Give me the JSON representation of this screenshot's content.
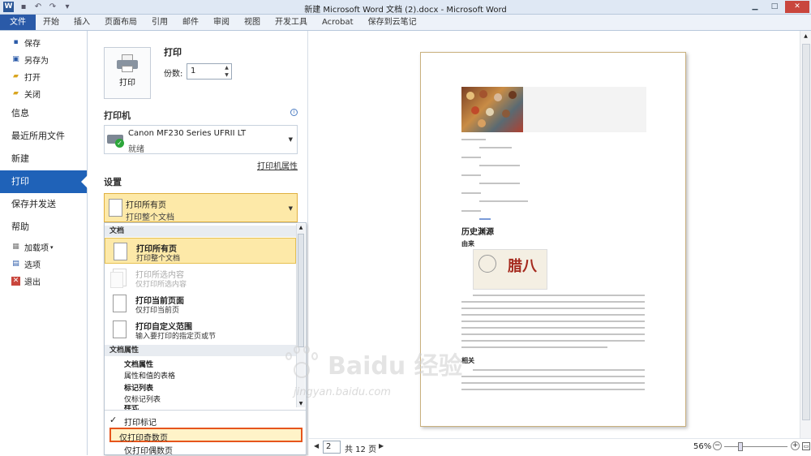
{
  "window": {
    "title": "新建 Microsoft Word 文档 (2).docx - Microsoft Word",
    "app_icon": "W"
  },
  "ribbon": {
    "tabs": [
      {
        "label": "文件",
        "active": true
      },
      {
        "label": "开始"
      },
      {
        "label": "插入"
      },
      {
        "label": "页面布局"
      },
      {
        "label": "引用"
      },
      {
        "label": "邮件"
      },
      {
        "label": "审阅"
      },
      {
        "label": "视图"
      },
      {
        "label": "开发工具"
      },
      {
        "label": "Acrobat"
      },
      {
        "label": "保存到云笔记"
      }
    ]
  },
  "nav": {
    "save": "保存",
    "save_as": "另存为",
    "open": "打开",
    "close": "关闭",
    "info": "信息",
    "recent": "最近所用文件",
    "new": "新建",
    "print": "打印",
    "save_send": "保存并发送",
    "help": "帮助",
    "addins": "加载项",
    "options": "选项",
    "exit": "退出"
  },
  "print_panel": {
    "section_title": "打印",
    "print_button": "打印",
    "copies_label": "份数:",
    "copies_value": "1",
    "printer_section": "打印机",
    "printer_name": "Canon MF230 Series UFRII LT",
    "printer_status": "就绪",
    "printer_properties": "打印机属性",
    "settings_section": "设置",
    "range_title": "打印所有页",
    "range_sub": "打印整个文档"
  },
  "dropdown": {
    "group_doc": "文档",
    "options": [
      {
        "title": "打印所有页",
        "sub": "打印整个文档"
      },
      {
        "title": "打印所选内容",
        "sub": "仅打印所选内容"
      },
      {
        "title": "打印当前页面",
        "sub": "仅打印当前页"
      },
      {
        "title": "打印自定义范围",
        "sub": "输入要打印的指定页或节"
      }
    ],
    "group_props": "文档属性",
    "props": [
      {
        "label": "文档属性",
        "bold": true
      },
      {
        "label": "属性和值的表格",
        "bold": false
      },
      {
        "label": "标记列表",
        "bold": true
      },
      {
        "label": "仅标记列表",
        "bold": false
      },
      {
        "label": "样式",
        "bold": true
      }
    ],
    "print_markup": "打印标记",
    "odd_pages": "仅打印奇数页",
    "even_pages": "仅打印偶数页"
  },
  "preview": {
    "heading_history": "历史渊源",
    "heading_origin": "由来",
    "heading_related": "相关",
    "poster_big": "腊八",
    "current_page": "2",
    "total_pages": "共 12 页",
    "zoom": "56%",
    "zoom_percent": 56
  },
  "watermark": {
    "text": "Baidu 经验",
    "url": "jingyan.baidu.com"
  }
}
